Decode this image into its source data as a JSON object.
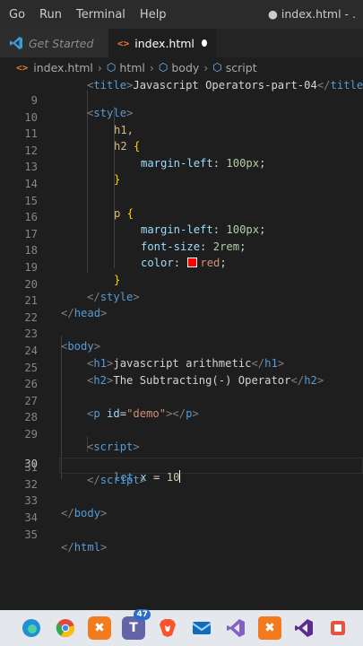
{
  "menubar": {
    "items": [
      "Go",
      "Run",
      "Terminal",
      "Help"
    ],
    "window_title": "● index.html - ."
  },
  "tabs": [
    {
      "label": "Get Started",
      "active": false
    },
    {
      "label": "index.html",
      "active": true,
      "modified": true
    }
  ],
  "breadcrumb": [
    "index.html",
    "html",
    "body",
    "script"
  ],
  "editor": {
    "cursor_line": 30,
    "line_numbers": [
      "9",
      "10",
      "11",
      "12",
      "13",
      "14",
      "15",
      "16",
      "17",
      "18",
      "19",
      "20",
      "21",
      "22",
      "23",
      "24",
      "25",
      "26",
      "27",
      "28",
      "29",
      "30",
      "31",
      "32",
      "33",
      "34",
      "35"
    ],
    "code": {
      "l9_open": "<",
      "l9_tag": "style",
      "l9_close": ">",
      "l10": "h1,",
      "l11_sel": "h2",
      "l11_brace": " {",
      "l12_prop": "margin-left",
      "l12_val": "100px",
      "l13": "}",
      "l15_sel": "p",
      "l15_brace": " {",
      "l16_prop": "margin-left",
      "l16_val": "100px",
      "l17_prop": "font-size",
      "l17_val": "2rem",
      "l18_prop": "color",
      "l18_val": "red",
      "l19": "}",
      "l20_tag": "style",
      "l21_tag": "head",
      "l23_tag": "body",
      "l24_text": "javascript arithmetic",
      "l24_tag": "h1",
      "l25_text": "The Subtracting(-) Operator",
      "l25_tag": "h2",
      "l27_tag": "p",
      "l27_attr": "id",
      "l27_val": "\"demo\"",
      "l29_tag": "script",
      "l30_kw": "let",
      "l30_var": "x",
      "l30_op": "=",
      "l30_num": "10",
      "l31_tag": "script",
      "l33_tag": "body",
      "l35_tag": "html"
    }
  },
  "taskbar": {
    "apps": [
      "edge-icon",
      "chrome-icon",
      "xampp-icon",
      "teams-icon",
      "brave-icon",
      "mail-icon",
      "visual-studio-icon",
      "xampp-control-icon",
      "visual-studio-purple-icon",
      "snipping-icon"
    ],
    "teams_badge": "47"
  }
}
